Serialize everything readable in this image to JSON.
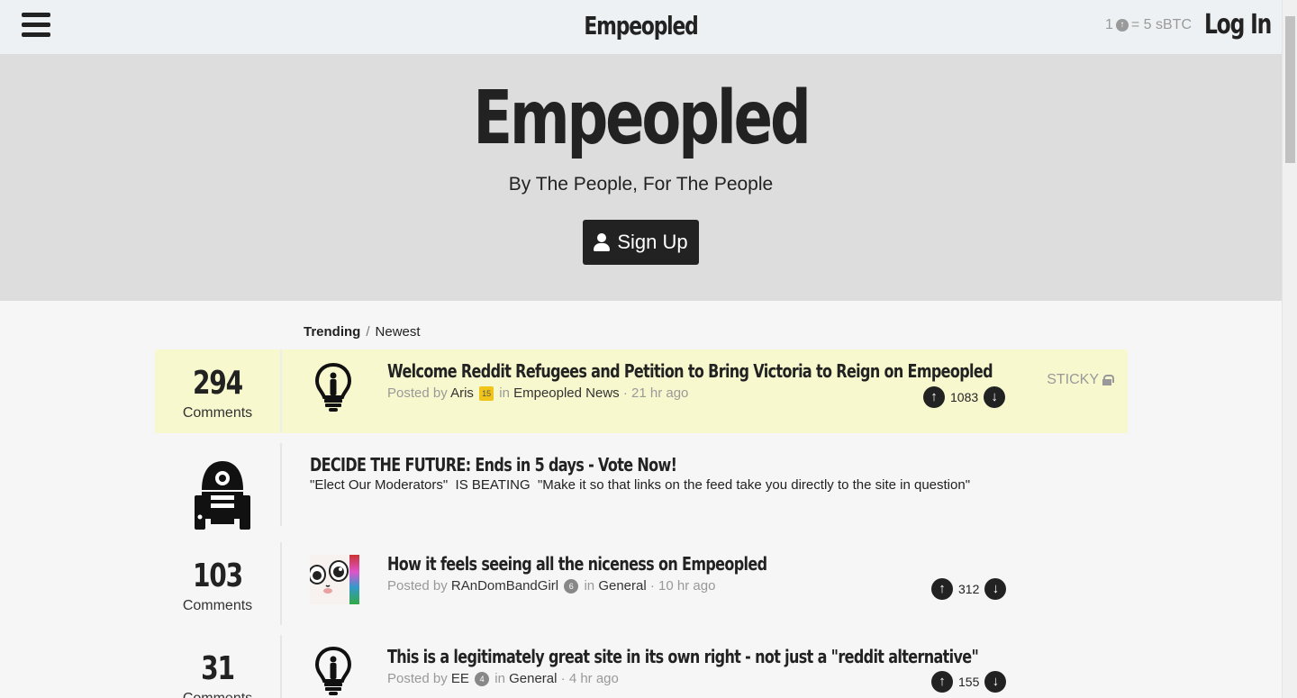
{
  "header": {
    "brand": "Empeopled",
    "rate_left": "1",
    "rate_right": "= 5 sBTC",
    "login_label": "Log In"
  },
  "hero": {
    "title": "Empeopled",
    "subtitle": "By The People, For The People",
    "signup_label": "Sign Up"
  },
  "tabs": {
    "trending": "Trending",
    "separator": "/",
    "newest": "Newest"
  },
  "posts": [
    {
      "comments": "294",
      "comments_label": "Comments",
      "title": "Welcome Reddit Refugees and Petition to Bring Victoria to Reign on Empeopled",
      "posted_by": "Posted by",
      "author": "Aris",
      "badge": "15",
      "in": "in",
      "community": "Empeopled News",
      "time": "· 21 hr ago",
      "votes": "1083",
      "sticky": "STICKY",
      "icon": "lightbulb-icon"
    },
    {
      "title": "DECIDE THE FUTURE: Ends in 5 days - Vote Now!",
      "description": "\"Elect Our Moderators\"  IS BEATING  \"Make it so that links on the feed take you directly to the site in question\"",
      "icon": "robot-icon"
    },
    {
      "comments": "103",
      "comments_label": "Comments",
      "title": "How it feels seeing all the niceness on Empeopled",
      "posted_by": "Posted by",
      "author": "RAnDomBandGirl",
      "badge": "6",
      "in": "in",
      "community": "General",
      "time": "· 10 hr ago",
      "votes": "312"
    },
    {
      "comments": "31",
      "comments_label": "Comments",
      "title": "This is a legitimately great site in its own right - not just a \"reddit alternative\"",
      "posted_by": "Posted by",
      "author": "EE",
      "badge": "4",
      "in": "in",
      "community": "General",
      "time": "· 4 hr ago",
      "votes": "155",
      "icon": "lightbulb-icon"
    }
  ]
}
